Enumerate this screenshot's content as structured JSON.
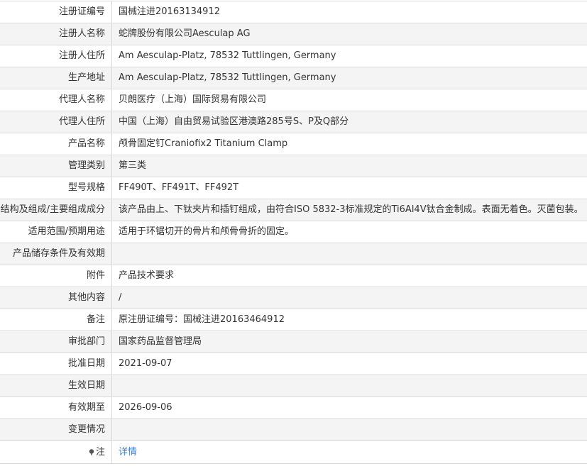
{
  "colors": {
    "border": "#d9d9d9",
    "alt_row_bg": "#f4f4f4",
    "text": "#333333",
    "link": "#3a7fd4"
  },
  "rows": [
    {
      "label": "注册证编号",
      "value": "国械注进20163134912"
    },
    {
      "label": "注册人名称",
      "value": "蛇牌股份有限公司Aesculap AG"
    },
    {
      "label": "注册人住所",
      "value": "Am Aesculap-Platz, 78532 Tuttlingen, Germany"
    },
    {
      "label": "生产地址",
      "value": "Am Aesculap-Platz, 78532 Tuttlingen, Germany"
    },
    {
      "label": "代理人名称",
      "value": "贝朗医疗（上海）国际贸易有限公司"
    },
    {
      "label": "代理人住所",
      "value": "中国（上海）自由贸易试验区港澳路285号S、P及Q部分"
    },
    {
      "label": "产品名称",
      "value": "颅骨固定钉Craniofix2 Titanium Clamp"
    },
    {
      "label": "管理类别",
      "value": "第三类"
    },
    {
      "label": "型号规格",
      "value": "FF490T、FF491T、FF492T"
    },
    {
      "label": "结构及组成/主要组成成分",
      "value": "该产品由上、下钛夹片和插钉组成，由符合ISO 5832-3标准规定的Ti6Al4V钛合金制成。表面无着色。灭菌包装。"
    },
    {
      "label": "适用范围/预期用途",
      "value": "适用于环锯切开的骨片和颅骨骨折的固定。"
    },
    {
      "label": "产品储存条件及有效期",
      "value": ""
    },
    {
      "label": "附件",
      "value": "产品技术要求"
    },
    {
      "label": "其他内容",
      "value": "/"
    },
    {
      "label": "备注",
      "value": "原注册证编号：国械注进20163464912"
    },
    {
      "label": "审批部门",
      "value": "国家药品监督管理局"
    },
    {
      "label": "批准日期",
      "value": "2021-09-07"
    },
    {
      "label": "生效日期",
      "value": ""
    },
    {
      "label": "有效期至",
      "value": "2026-09-06"
    },
    {
      "label": "变更情况",
      "value": ""
    }
  ],
  "note_row": {
    "icon": "pin-icon",
    "label": "注",
    "link_text": "详情"
  }
}
